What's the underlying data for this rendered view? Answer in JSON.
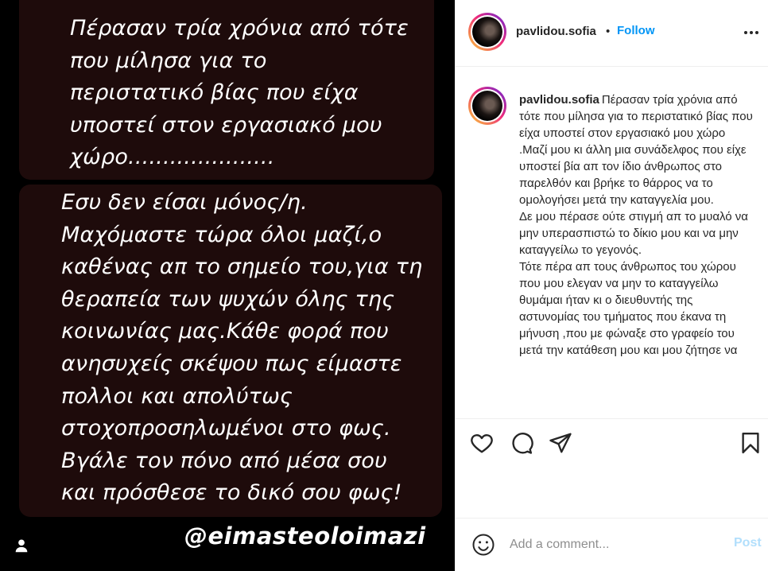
{
  "post_image": {
    "text_block_1": "Πέρασαν τρία χρόνια από τότε\nπου μίλησα για το\nπεριστατικό βίας που είχα\nυποστεί στον εργασιακό μου\nχώρο.....................",
    "text_block_2": "Εσυ δεν είσαι μόνος/η.\nΜαχόμαστε τώρα όλοι μαζί,ο\nκαθένας απ το σημείο του,για τη\nθεραπεία των ψυχών όλης της\nκοινωνίας μας.Κάθε φορά που\nανησυχείς σκέψου πως είμαστε\nπολλοι και απολύτως\nστοχοπροσηλωμένοι στο φως.\nΒγάλε τον πόνο από μέσα σου\nκαι πρόσθεσε το δικό σου φως!",
    "handle": "@eimasteoloimazi",
    "user_tag_icon": "person-icon"
  },
  "header": {
    "username": "pavlidou.sofia",
    "separator": "•",
    "follow_label": "Follow",
    "more_icon": "more-horizontal-icon"
  },
  "caption": {
    "username": "pavlidou.sofia",
    "text": "Πέρασαν τρία χρόνια από τότε που μίλησα για το περιστατικό βίας που είχα υποστεί στον εργασιακό μου χώρο .Μαζί μου κι άλλη μια συνάδελφος που είχε υποστεί βία απ τον ίδιο άνθρωπος στο παρελθόν και βρήκε το θάρρος να το ομολογήσει μετά την καταγγελία μου.\nΔε μου πέρασε ούτε στιγμή απ το μυαλό να μην υπερασπιστώ το δίκιο μου και να μην καταγγείλω το γεγονός.\nΤότε πέρα απ τους άνθρωπος του χώρου που μου ελεγαν να μην το καταγγείλω θυμάμαι ήταν κι ο διευθυντής της αστυνομίας του τμήματος που έκανα τη μήνυση ,που με φώναξε στο γραφείο του μετά την κατάθεση μου και μου ζήτησε να"
  },
  "actions": {
    "like_icon": "heart-icon",
    "comment_icon": "comment-bubble-icon",
    "share_icon": "paper-plane-icon",
    "save_icon": "bookmark-icon"
  },
  "comment_bar": {
    "emoji_icon": "emoji-smile-icon",
    "placeholder": "Add a comment...",
    "post_label": "Post"
  },
  "colors": {
    "accent": "#0095f6",
    "post_disabled": "#b2dffc",
    "text": "#262626",
    "muted": "#8e8e8e",
    "panel": "#1e0b0b"
  }
}
